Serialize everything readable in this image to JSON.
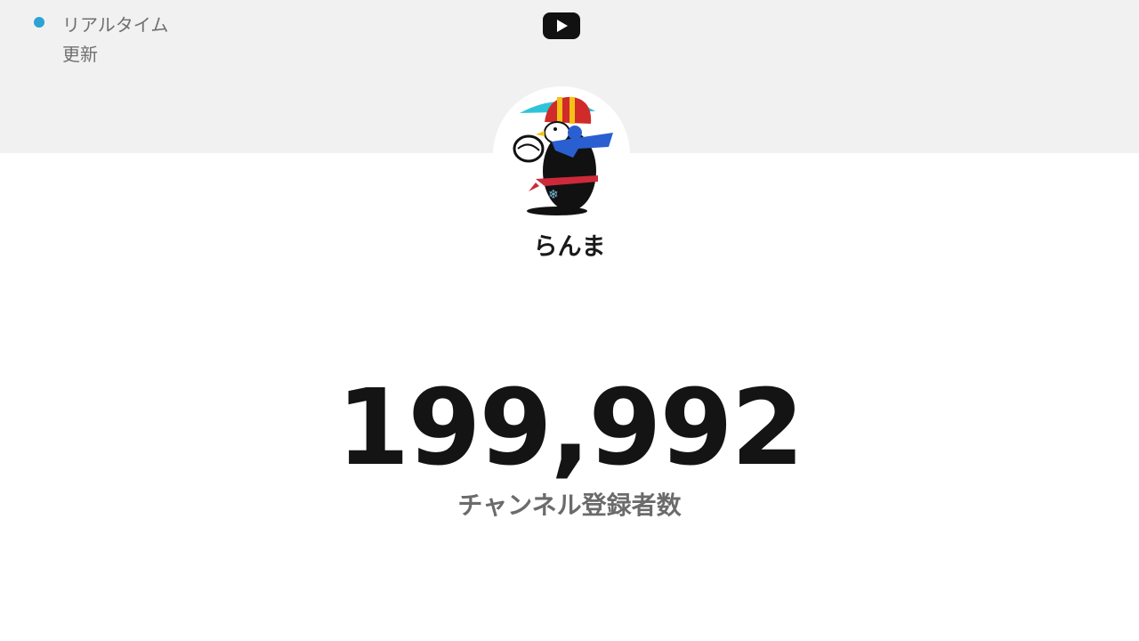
{
  "live_indicator": {
    "label": "リアルタイム更新",
    "dot_color": "#2aa3d6"
  },
  "header": {
    "logo_icon": "youtube-logo-icon",
    "band_color": "#f1f1f1"
  },
  "channel": {
    "avatar_icon": "penguin-avatar",
    "name": "らんま"
  },
  "stats": {
    "subscriber_count": "199,992",
    "subscriber_label": "チャンネル登録者数"
  }
}
